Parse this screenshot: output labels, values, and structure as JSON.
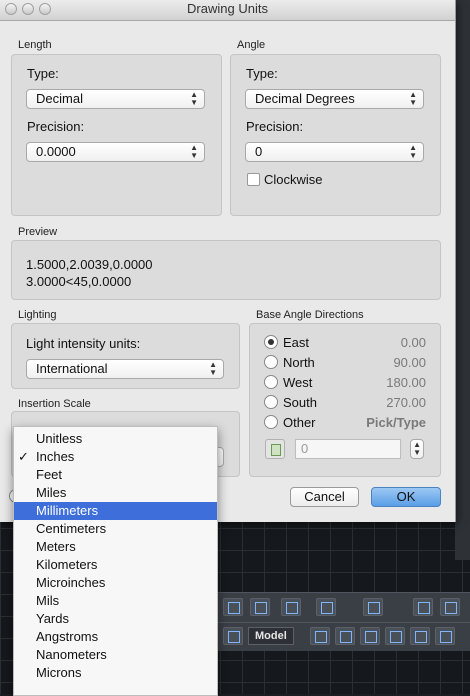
{
  "title": "Drawing Units",
  "length": {
    "section_label": "Length",
    "type_label": "Type:",
    "type_value": "Decimal",
    "precision_label": "Precision:",
    "precision_value": "0.0000"
  },
  "angle": {
    "section_label": "Angle",
    "type_label": "Type:",
    "type_value": "Decimal Degrees",
    "precision_label": "Precision:",
    "precision_value": "0",
    "clockwise_label": "Clockwise",
    "clockwise_checked": false
  },
  "preview": {
    "section_label": "Preview",
    "line1": "1.5000,2.0039,0.0000",
    "line2": "3.0000<45,0.0000"
  },
  "lighting": {
    "section_label": "Lighting",
    "units_label": "Light intensity units:",
    "units_value": "International"
  },
  "base_angle": {
    "section_label": "Base Angle Directions",
    "directions": [
      {
        "name": "East",
        "value": "0.00",
        "selected": true
      },
      {
        "name": "North",
        "value": "90.00",
        "selected": false
      },
      {
        "name": "West",
        "value": "180.00",
        "selected": false
      },
      {
        "name": "South",
        "value": "270.00",
        "selected": false
      },
      {
        "name": "Other",
        "value": "Pick/Type",
        "selected": false
      }
    ],
    "other_value": "0"
  },
  "insertion_scale": {
    "section_label": "Insertion Scale",
    "options": [
      "Unitless",
      "Inches",
      "Feet",
      "Miles",
      "Millimeters",
      "Centimeters",
      "Meters",
      "Kilometers",
      "Microinches",
      "Mils",
      "Yards",
      "Angstroms",
      "Nanometers",
      "Microns"
    ],
    "checked": "Inches",
    "highlighted": "Millimeters"
  },
  "buttons": {
    "cancel": "Cancel",
    "ok": "OK"
  },
  "cad_toolbar": {
    "model_label": "Model"
  },
  "colors": {
    "accent": "#3d6ed9",
    "ok_button": "#5b9ee6",
    "dialog_bg": "#e9e9e9"
  }
}
